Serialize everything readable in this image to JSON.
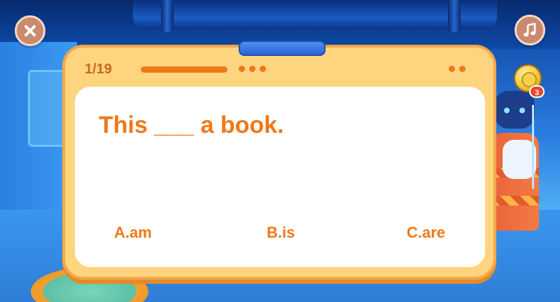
{
  "header": {
    "progress_text": "1/19",
    "progress_fraction": 0.0526
  },
  "icons": {
    "close": "close-icon",
    "music": "music-note-icon",
    "coin": "coin-icon"
  },
  "coin": {
    "count": "3"
  },
  "question": {
    "text": "This ___ a book."
  },
  "options": [
    {
      "label": "A.am"
    },
    {
      "label": "B.is"
    },
    {
      "label": "C.are"
    }
  ],
  "colors": {
    "accent": "#f07818",
    "card": "#ffd47e",
    "button": "#c98a6e"
  }
}
